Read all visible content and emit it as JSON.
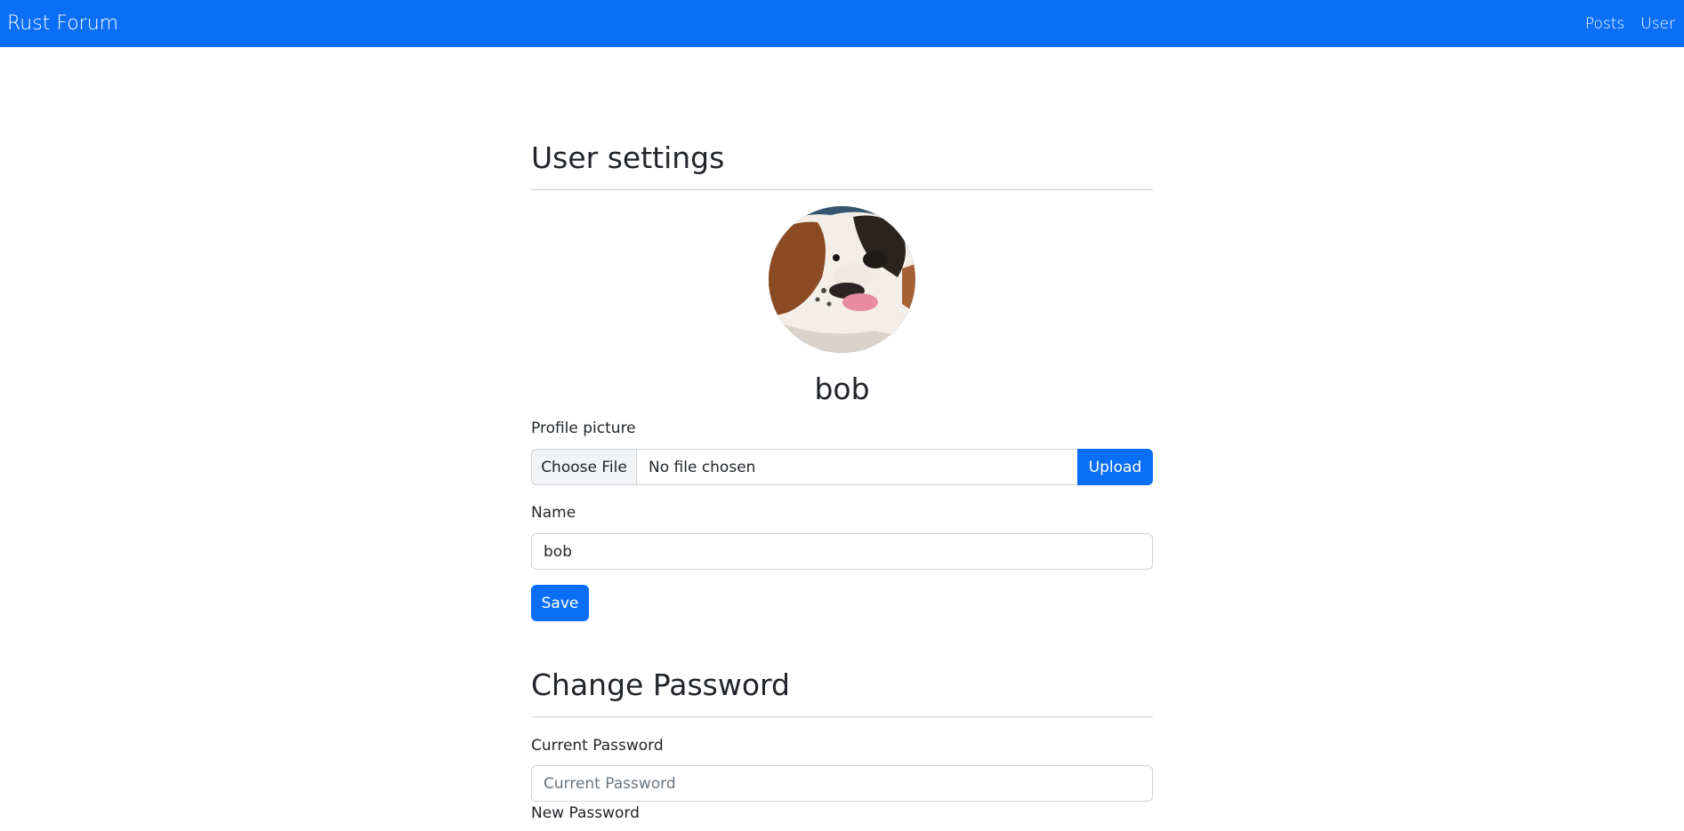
{
  "navbar": {
    "brand": "Rust Forum",
    "links": [
      "Posts",
      "User"
    ]
  },
  "settings": {
    "title": "User settings",
    "username": "bob",
    "profile_picture_label": "Profile picture",
    "choose_file_label": "Choose File",
    "file_status": "No file chosen",
    "upload_label": "Upload",
    "name_label": "Name",
    "name_value": "bob",
    "save_label": "Save"
  },
  "password": {
    "title": "Change Password",
    "current_label": "Current Password",
    "current_placeholder": "Current Password",
    "new_label": "New Password"
  },
  "colors": {
    "primary": "#0a6ef7"
  }
}
